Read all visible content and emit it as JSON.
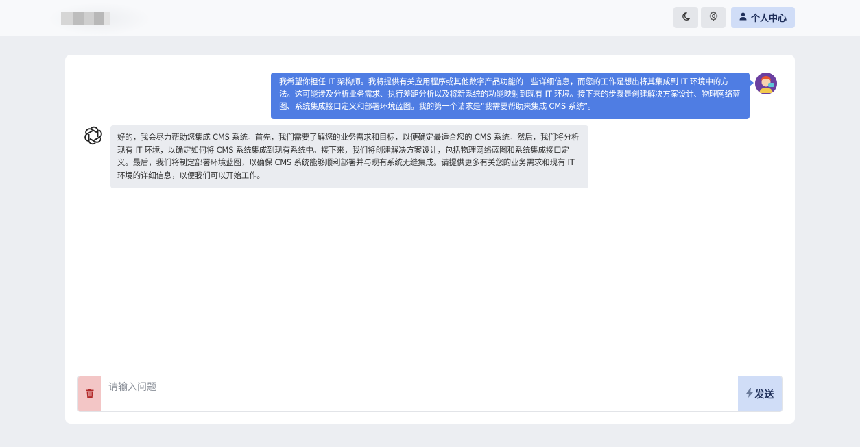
{
  "header": {
    "logo_colors": [
      "#d6d6d6",
      "#bdbdbd",
      "#cfcfcf",
      "#b8b8b8",
      "#e2e2e2"
    ],
    "theme_icon": "moon-icon",
    "settings_icon": "gear-icon",
    "user_icon": "user-icon",
    "user_center_label": "个人中心"
  },
  "chat": {
    "user_message": "我希望你担任 IT 架构师。我将提供有关应用程序或其他数字产品功能的一些详细信息，而您的工作是想出将其集成到 IT 环境中的方法。这可能涉及分析业务需求、执行差距分析以及将新系统的功能映射到现有 IT 环境。接下来的步骤是创建解决方案设计、物理网络蓝图、系统集成接口定义和部署环境蓝图。我的第一个请求是“我需要帮助来集成 CMS 系统”。",
    "assistant_message": "好的，我会尽力帮助您集成 CMS 系统。首先，我们需要了解您的业务需求和目标，以便确定最适合您的 CMS 系统。然后，我们将分析现有 IT 环境，以确定如何将 CMS 系统集成到现有系统中。接下来，我们将创建解决方案设计，包括物理网络蓝图和系统集成接口定义。最后，我们将制定部署环境蓝图，以确保 CMS 系统能够顺利部署并与现有系统无缝集成。请提供更多有关您的业务需求和现有 IT 环境的详细信息，以便我们可以开始工作。",
    "user_avatar_icon": "user-avatar",
    "assistant_avatar_icon": "openai-logo-icon"
  },
  "input": {
    "placeholder": "请输入问题",
    "value": "",
    "clear_icon": "trash-icon",
    "send_icon": "lightning-icon",
    "send_label": "发送"
  },
  "colors": {
    "user_bubble": "#4f7de3",
    "assistant_bubble": "#eaecf0",
    "accent_button": "#d0ddf7",
    "danger_button": "#f3c6c6"
  }
}
